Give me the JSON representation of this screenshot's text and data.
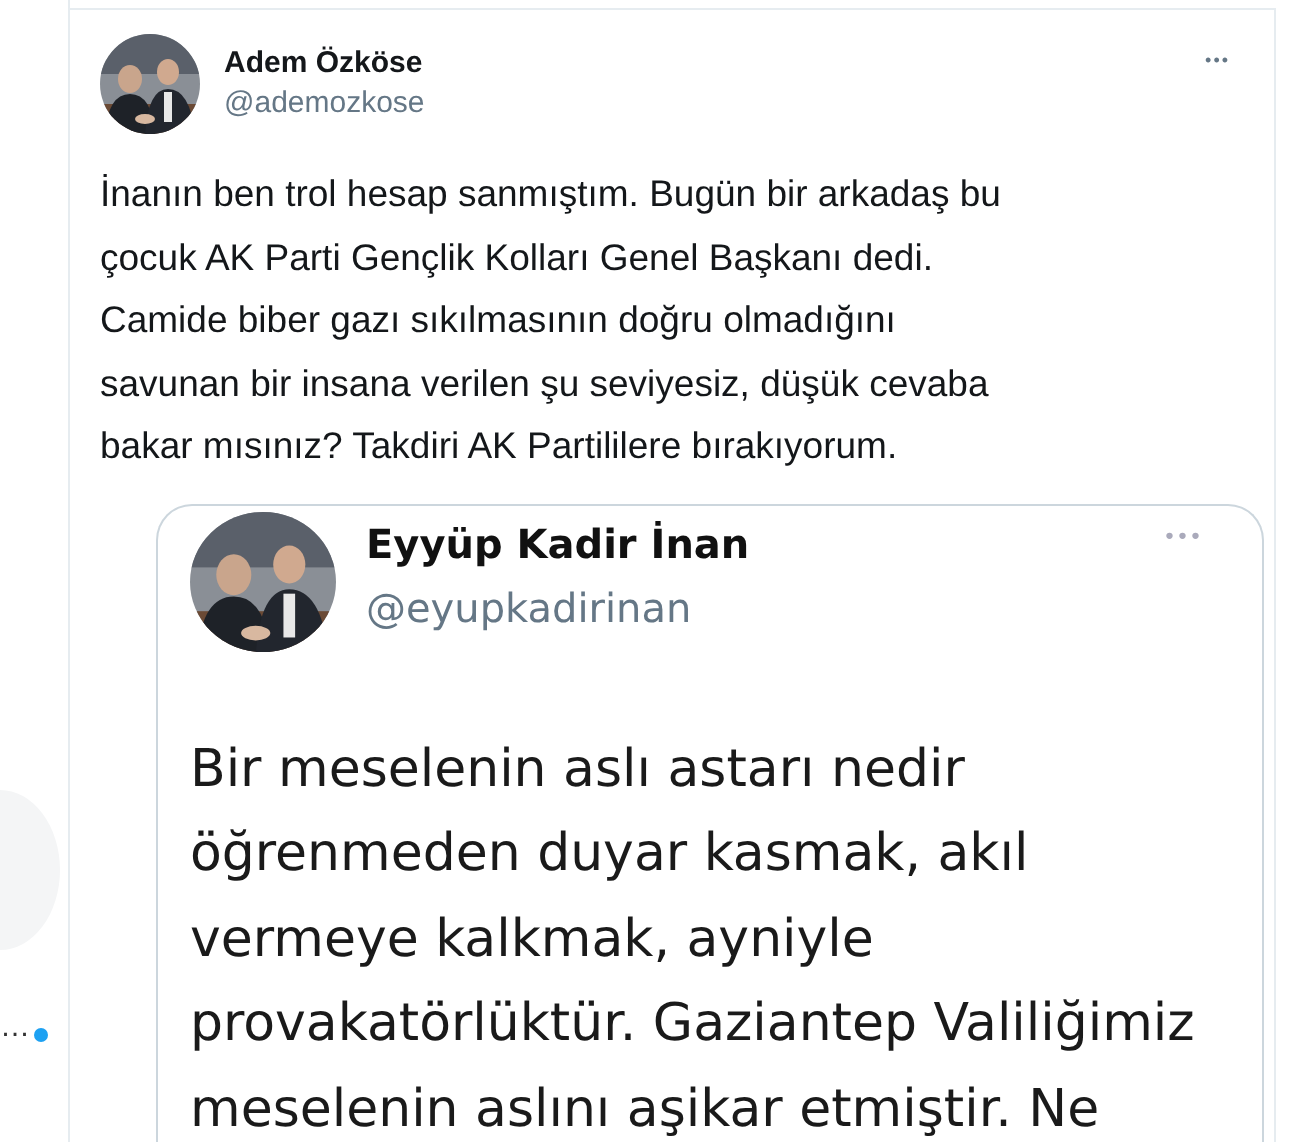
{
  "sidebar": {
    "ellipsis": "…"
  },
  "tweet": {
    "author": {
      "name": "Adem Özköse",
      "handle": "@ademozkose"
    },
    "more": "•••",
    "text": [
      "İnanın ben trol hesap sanmıştım. Bugün bir arkadaş bu",
      "çocuk AK Parti Gençlik Kolları Genel Başkanı dedi.",
      "Camide biber gazı sıkılmasının doğru olmadığını",
      "savunan bir insana verilen şu seviyesiz, düşük cevaba",
      "bakar mısınız? Takdiri AK Partililere bırakıyorum."
    ],
    "attached_screenshot": {
      "author": {
        "name": "Eyyüp Kadir İnan",
        "handle": "@eyupkadirinan"
      },
      "more": "•••",
      "text": [
        "Bir meselenin aslı astarı nedir",
        "öğrenmeden duyar kasmak, akıl",
        "vermeye kalkmak, ayniyle",
        "provakatörlüktür. Gaziantep Valiliğimiz",
        "meselenin aslını aşikar etmiştir. Ne"
      ]
    }
  }
}
